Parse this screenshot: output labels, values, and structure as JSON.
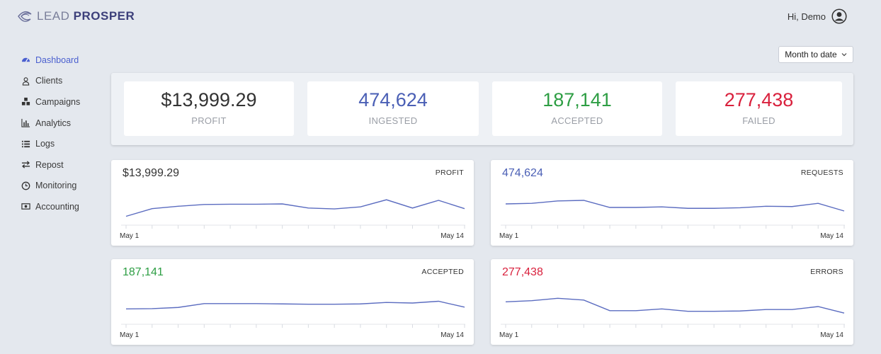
{
  "header": {
    "logo_lead": "LEAD",
    "logo_prosper": "PROSPER",
    "greeting": "Hi, Demo"
  },
  "icons": {
    "avatar": "user-circle-icon",
    "range_chevron": "chevron-down-icon"
  },
  "sidebar": {
    "items": [
      {
        "label": "Dashboard",
        "icon": "dashboard-icon",
        "active": true
      },
      {
        "label": "Clients",
        "icon": "user-icon",
        "active": false
      },
      {
        "label": "Campaigns",
        "icon": "cubes-icon",
        "active": false
      },
      {
        "label": "Analytics",
        "icon": "bar-chart-icon",
        "active": false
      },
      {
        "label": "Logs",
        "icon": "list-icon",
        "active": false
      },
      {
        "label": "Repost",
        "icon": "exchange-icon",
        "active": false
      },
      {
        "label": "Monitoring",
        "icon": "clock-icon",
        "active": false
      },
      {
        "label": "Accounting",
        "icon": "money-icon",
        "active": false
      }
    ]
  },
  "range_selector": {
    "label": "Month to date"
  },
  "stats": [
    {
      "value": "$13,999.29",
      "label": "PROFIT"
    },
    {
      "value": "474,624",
      "label": "INGESTED"
    },
    {
      "value": "187,141",
      "label": "ACCEPTED"
    },
    {
      "value": "277,438",
      "label": "FAILED"
    }
  ],
  "colors": {
    "accent": "#4a5fcf",
    "line": "#5b6cc0",
    "blue": "#4a5fb5",
    "green": "#2e9e44",
    "red": "#d9213d",
    "dark": "#333333"
  },
  "chart_data": [
    {
      "type": "line",
      "title": "PROFIT",
      "value": "$13,999.29",
      "x_start": "May 1",
      "x_end": "May 14",
      "series": [
        {
          "values": [
            15,
            28,
            32,
            35,
            35.5,
            35.5,
            36,
            29,
            27.5,
            31,
            43,
            29,
            42,
            28
          ]
        }
      ],
      "ylim": [
        0,
        60
      ]
    },
    {
      "type": "line",
      "title": "REQUESTS",
      "value": "474,624",
      "x_start": "May 1",
      "x_end": "May 14",
      "series": [
        {
          "values": [
            36,
            37,
            41,
            42,
            30,
            30,
            31,
            28.5,
            28.5,
            29.5,
            32,
            31.5,
            37,
            24
          ]
        }
      ],
      "ylim": [
        0,
        60
      ]
    },
    {
      "type": "line",
      "title": "ACCEPTED",
      "value": "187,141",
      "x_start": "May 1",
      "x_end": "May 14",
      "series": [
        {
          "values": [
            26,
            26.5,
            28.5,
            35,
            35,
            35,
            34.5,
            34,
            34,
            34.5,
            37,
            36,
            39,
            29
          ]
        }
      ],
      "ylim": [
        0,
        60
      ]
    },
    {
      "type": "line",
      "title": "ERRORS",
      "value": "277,438",
      "x_start": "May 1",
      "x_end": "May 14",
      "series": [
        {
          "values": [
            38,
            40,
            44,
            41,
            23,
            23,
            26,
            22,
            22,
            22.5,
            25,
            25,
            30,
            19
          ]
        }
      ],
      "ylim": [
        0,
        60
      ]
    }
  ]
}
